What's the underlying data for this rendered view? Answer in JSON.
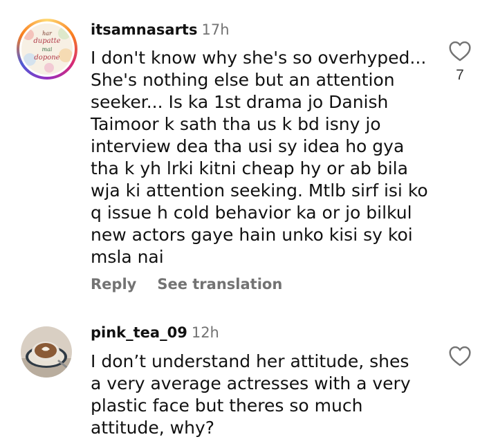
{
  "comments": [
    {
      "username": "itsamnasarts",
      "time": "17h",
      "avatar_text": [
        "har",
        "dupatte",
        "mai",
        "dopone"
      ],
      "text": "I don't know why she's so overhyped... She's nothing else but an attention seeker... Is ka 1st drama jo Danish Taimoor k sath tha us k bd isny jo interview dea tha usi sy idea ho gya tha k yh lrki kitni cheap hy or ab bila wja ki attention seeking. Mtlb sirf isi ko q issue h cold behavior ka or jo bilkul new actors gaye hain unko kisi sy koi msla nai",
      "like_icon": "heart-outline-icon",
      "like_count": "7",
      "reply_label": "Reply",
      "translate_label": "See translation"
    },
    {
      "username": "pink_tea_09",
      "time": "12h",
      "text": "I don’t understand her attitude, shes a very average actresses with a very plastic face but theres so much attitude, why?",
      "like_icon": "heart-outline-icon"
    }
  ],
  "colors": {
    "text": "#111111",
    "muted": "#737373",
    "story_ring": [
      "#feda75",
      "#fa7e1e",
      "#d62976",
      "#962fbf",
      "#4f5bd5"
    ]
  }
}
